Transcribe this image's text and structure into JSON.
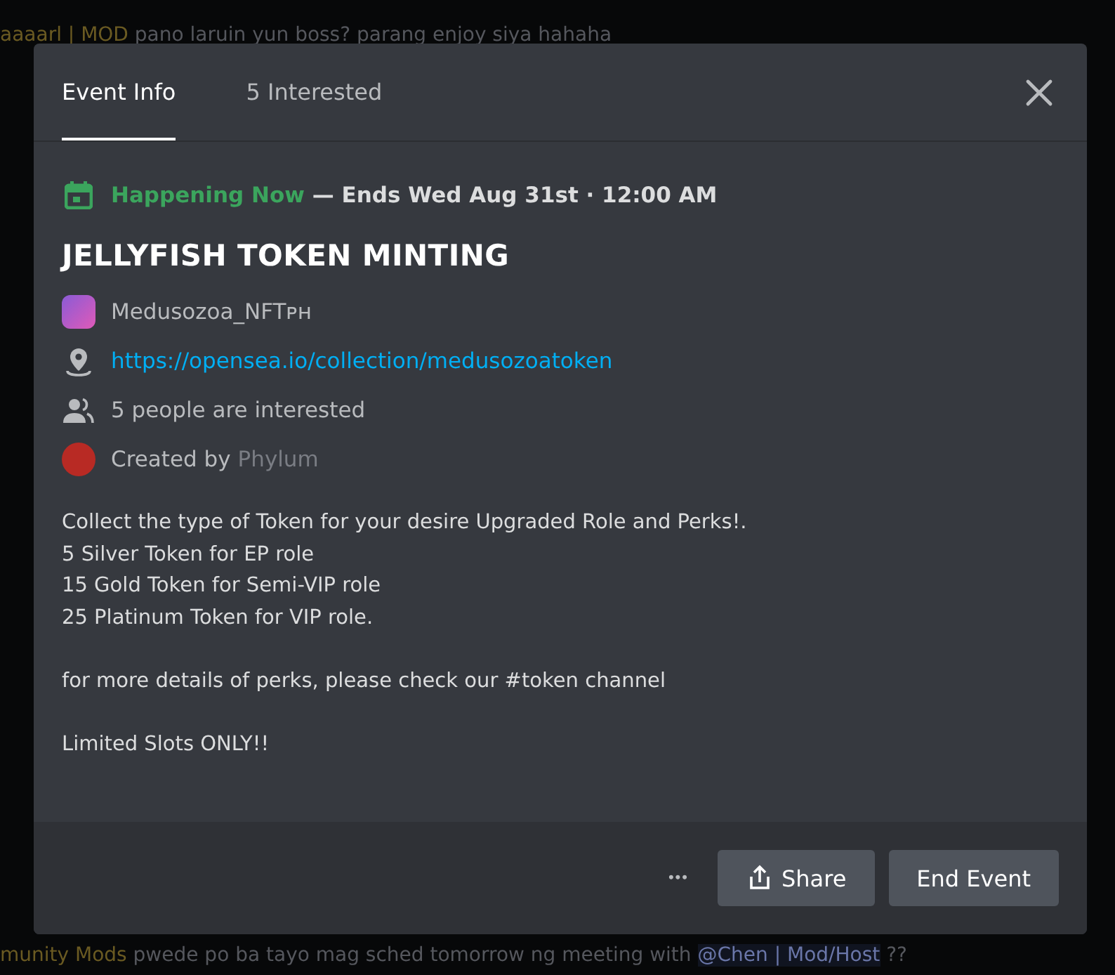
{
  "background_chat": {
    "top_message": {
      "author": "aaaarl | MOD",
      "text": "pano laruin yun boss? parang enjoy siya hahaha"
    },
    "bottom_message": {
      "author": "munity Mods",
      "text": "pwede po ba tayo mag sched tomorrow ng meeting with",
      "mention": "@Chen | Mod/Host",
      "suffix": "??"
    }
  },
  "modal": {
    "tabs": [
      {
        "label": "Event Info",
        "selected": true
      },
      {
        "label": "5 Interested",
        "selected": false
      }
    ],
    "status": {
      "label": "Happening Now",
      "detail": "— Ends Wed Aug 31st · 12:00 AM"
    },
    "title": "JELLYFISH TOKEN MINTING",
    "details": [
      {
        "kind": "server",
        "text": "Medusozoa_NFTᴘʜ"
      },
      {
        "kind": "link",
        "text": "https://opensea.io/collection/medusozoatoken"
      },
      {
        "kind": "interested",
        "text": "5 people are interested"
      },
      {
        "kind": "creator",
        "text": "Created by",
        "name": "Phylum"
      }
    ],
    "description": [
      [
        "Collect the type of Token for your desire Upgraded Role and Perks!.",
        "5 Silver Token for EP role",
        "15 Gold Token for Semi-VIP role",
        "25 Platinum Token for VIP role."
      ],
      [
        "for more details of perks, please check our #token channel"
      ],
      [
        "Limited Slots ONLY!!"
      ]
    ],
    "footer": {
      "more": "•••",
      "share": "Share",
      "end": "End Event"
    }
  }
}
